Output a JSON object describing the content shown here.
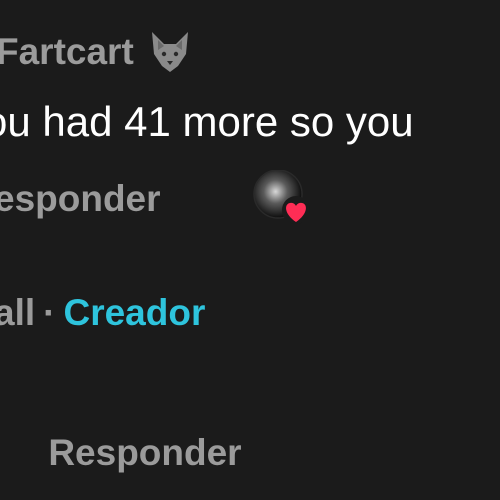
{
  "comment": {
    "username": "Fartcart",
    "username_icon": "wolf-icon",
    "text": "ou had 41 more so you",
    "reply_label": "esponder"
  },
  "reply": {
    "author_fragment": "all",
    "separator": "·",
    "creator_badge": "Creador",
    "creator_color": "#2ec4dd",
    "paren_fragment": ")",
    "reply_label": "Responder"
  },
  "creator_like_icon": "heart-avatar-icon",
  "colors": {
    "background": "#1b1b1b",
    "muted_text": "#9b9b9b",
    "primary_text": "#ffffff",
    "heart": "#ff2d55"
  }
}
